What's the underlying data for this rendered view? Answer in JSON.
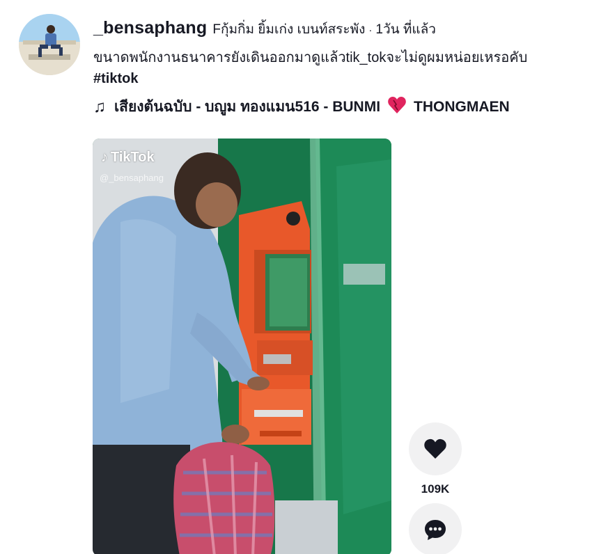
{
  "post": {
    "username": "_bensaphang",
    "nickname": "Fกุ้มกิ่ม ยิ้มเก่ง เบนท์สระพัง",
    "separator": "·",
    "time_ago": "1วัน ที่แล้ว",
    "caption": "ขนาดพนักงานธนาคารยังเดินออกมาดูแล้วtik_tokจะไม่ดูผมหน่อยเหรอคับ",
    "hashtag": "#tiktok"
  },
  "music": {
    "icon": "music-note-icon",
    "title_before": "เสียงต้นฉบับ - บญูม ทองแมน516 - BUNMI",
    "title_after": "THONGMAEN",
    "heart_color": "#e0245e"
  },
  "video": {
    "watermark_brand": "TikTok",
    "watermark_user": "@_bensaphang"
  },
  "actions": {
    "like_icon": "heart-icon",
    "like_count": "109K",
    "comment_icon": "comment-icon",
    "button_bg": "#f1f1f2"
  },
  "colors": {
    "text": "#161823",
    "atm_orange": "#e8582a",
    "booth_green": "#1f7a4c"
  }
}
